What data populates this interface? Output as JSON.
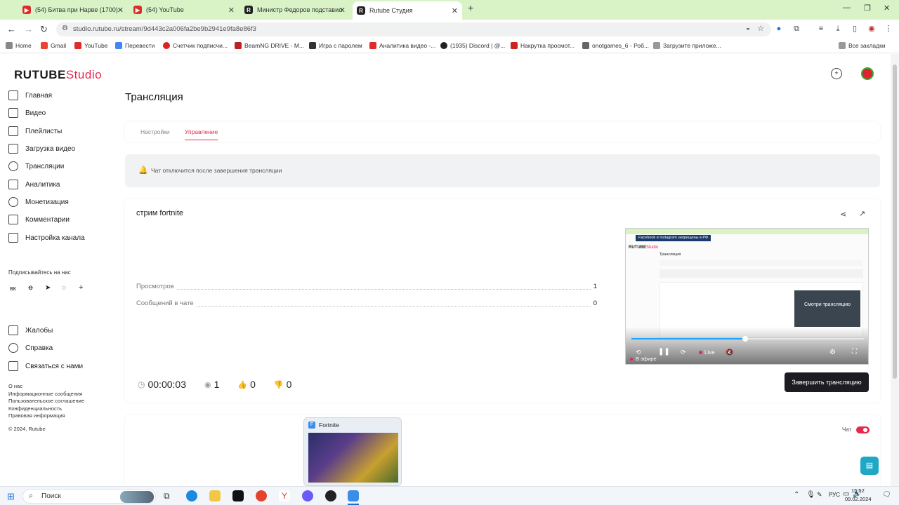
{
  "browser": {
    "tabs": [
      {
        "label": "(54) Битва при Нарве (1700) -",
        "icon_color": "#e02b2b"
      },
      {
        "label": "(54) YouTube",
        "icon_color": "#e02b2b"
      },
      {
        "label": "Министр Федоров подставил",
        "icon_color": "#222222"
      },
      {
        "label": "Rutube Студия",
        "icon_color": "#222222"
      }
    ],
    "new_tab": "+",
    "url": "studio.rutube.ru/stream/9d443c2a006fa2be9b2941e9fa8e86f3",
    "bookmarks": [
      "Home",
      "Gmail",
      "YouTube",
      "Перевести",
      "Счетчик подписчи...",
      "BeamNG DRIVE - M...",
      "Игра с паролем",
      "Аналитика видео -...",
      "(1935) Discord | @...",
      "Накрутка просмот...",
      "onotgames_6 - Роб...",
      "Загрузите приложе..."
    ],
    "all_bookmarks": "Все закладки"
  },
  "app": {
    "logo_main": "RUTUBE",
    "logo_sub": "Studio",
    "accent": "#e4294f",
    "sidebar": {
      "items": [
        "Главная",
        "Видео",
        "Плейлисты",
        "Загрузка видео",
        "Трансляции",
        "Аналитика",
        "Монетизация",
        "Комментарии",
        "Настройка канала"
      ],
      "subscribe_title": "Подписывайтесь на нас",
      "social": [
        "vk",
        "ok",
        "tg",
        "wa",
        "+"
      ],
      "bottom_items": [
        "Жалобы",
        "Справка",
        "Связаться с нами"
      ],
      "footer_links": [
        "О нас",
        "Информационные сообщения",
        "Пользовательское соглашение",
        "Конфиденциальность",
        "Правовая информация"
      ],
      "copyright": "© 2024, Rutube"
    },
    "page_title": "Трансляция",
    "tabs": [
      {
        "label": "Настройки",
        "active": false
      },
      {
        "label": "Управление",
        "active": true
      }
    ],
    "notice": "Чат отключится после завершения трансляции",
    "stream": {
      "title": "стрим fortnite",
      "views_label": "Просмотров",
      "views_value": "1",
      "messages_label": "Сообщений в чате",
      "messages_value": "0",
      "duration": "00:00:03",
      "viewers": "1",
      "likes": "0",
      "dislikes": "0",
      "finish_button": "Завершить трансляцию"
    },
    "player": {
      "banner": "Facebook и Instagram запрещены в РФ",
      "watch_label": "Смотри трансляцию",
      "live_label": "Live",
      "on_air": "В эфире",
      "progress": 0.49
    },
    "chat_toggle_label": "Чат",
    "chat_toggle_on": true
  },
  "taskbar": {
    "search": "Поиск",
    "lang": "РУС",
    "time": "15:52",
    "date": "09.02.2024",
    "preview_title": "Fortnite"
  }
}
